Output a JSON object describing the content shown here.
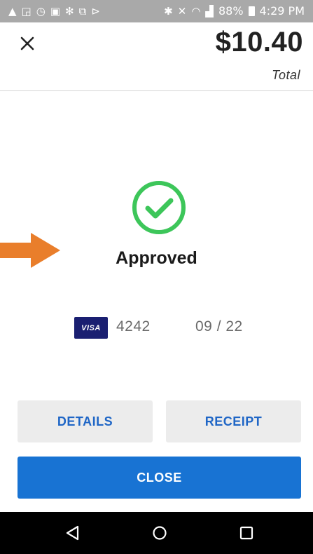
{
  "status_bar": {
    "left_icons": [
      "warning-icon",
      "screenshot-icon",
      "speedometer-icon",
      "gallery-icon",
      "pinwheel-icon",
      "card-reader-icon",
      "play-store-icon"
    ],
    "left_glyphs": [
      "▲",
      "◲",
      "◷",
      "▣",
      "✻",
      "⧉",
      "⊳"
    ],
    "right_glyphs": [
      "✱",
      "✕",
      "◠",
      "▟"
    ],
    "battery": "88%",
    "time": "4:29 PM"
  },
  "header": {
    "amount": "$10.40",
    "total_label": "Total"
  },
  "result": {
    "status": "Approved",
    "check_color": "#3dc65a"
  },
  "card": {
    "brand": "VISA",
    "last4": "4242",
    "expiry": "09 / 22"
  },
  "buttons": {
    "details": "DETAILS",
    "receipt": "RECEIPT",
    "close": "CLOSE"
  },
  "colors": {
    "accent": "#1873d3",
    "button_text": "#1f66c6",
    "arrow": "#e97e2b",
    "visa": "#1a1f71"
  }
}
